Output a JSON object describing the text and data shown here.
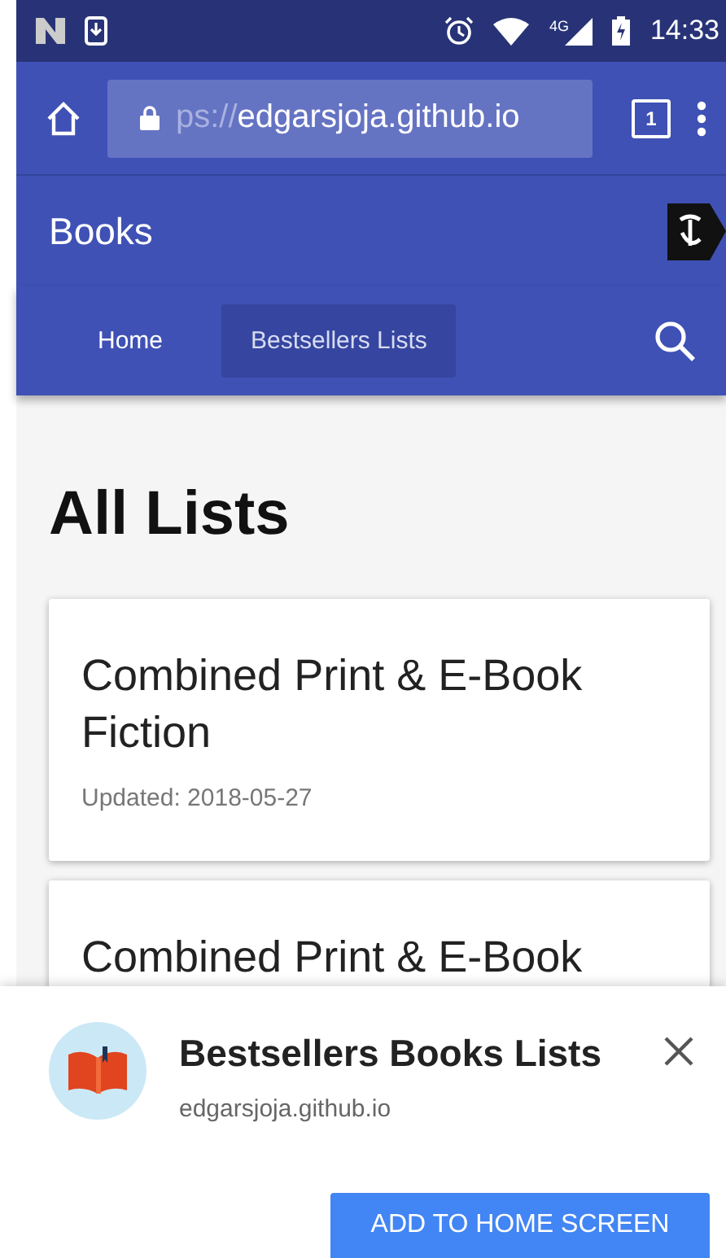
{
  "status_bar": {
    "network": "4G",
    "time": "14:33"
  },
  "browser": {
    "url_faded": "ps://",
    "url": "edgarsjoja.github.io",
    "tab_count": "1"
  },
  "app_bar": {
    "title": "Books"
  },
  "nav": {
    "tabs": [
      {
        "label": "Home",
        "selected": false
      },
      {
        "label": "Bestsellers Lists",
        "selected": true
      }
    ]
  },
  "page": {
    "heading": "All Lists",
    "cards": [
      {
        "title": "Combined Print & E-Book Fiction",
        "updated": "Updated: 2018-05-27"
      },
      {
        "title": "Combined Print & E-Book"
      }
    ]
  },
  "install_sheet": {
    "app_name": "Bestsellers Books Lists",
    "domain": "edgarsjoja.github.io",
    "button": "ADD TO HOME SCREEN"
  }
}
